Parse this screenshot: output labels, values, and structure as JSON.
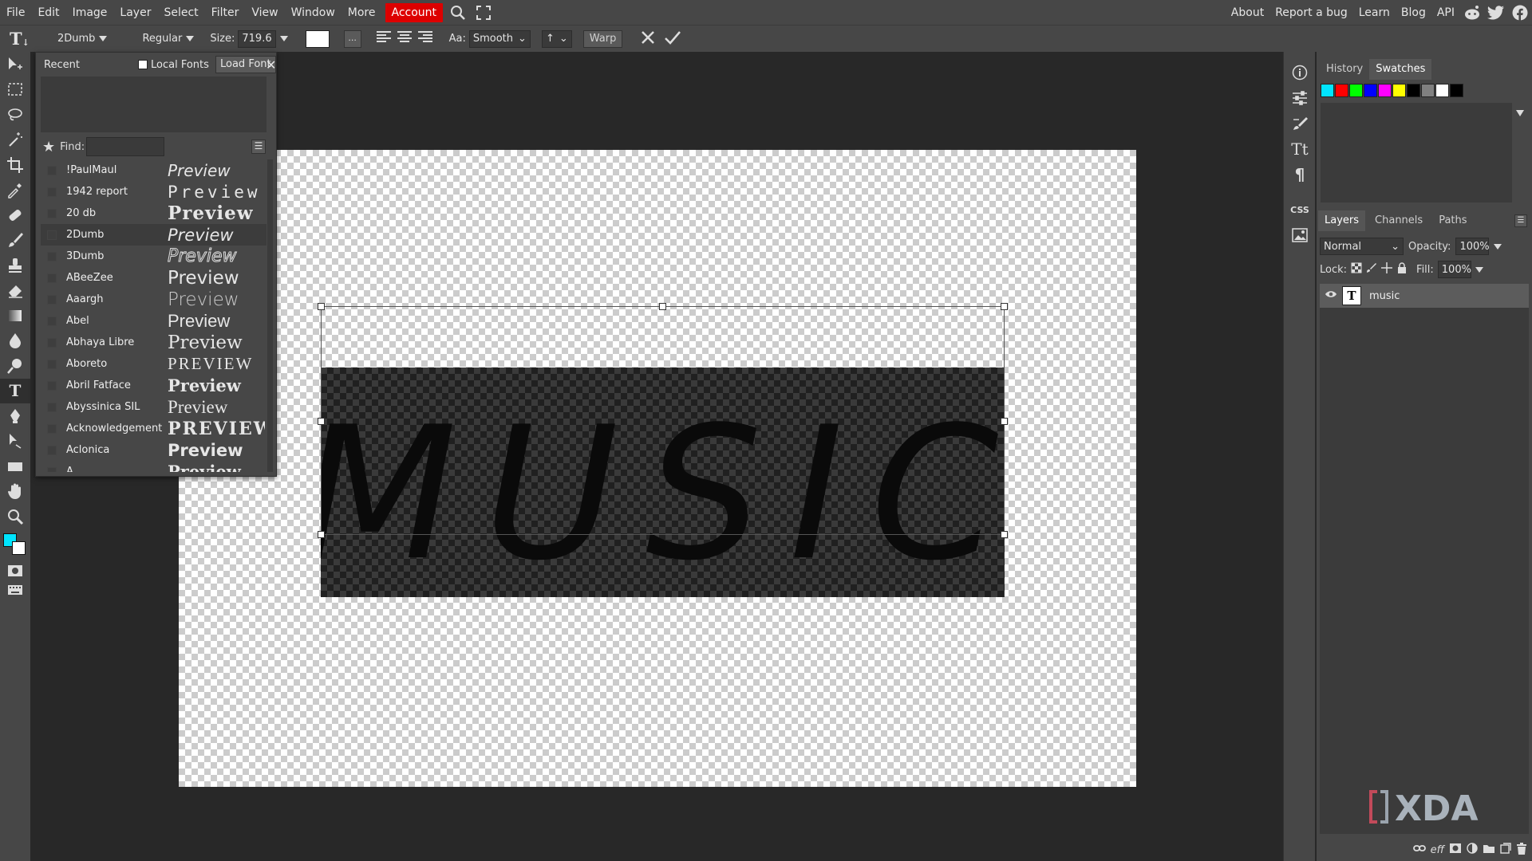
{
  "menubar": {
    "items": [
      "File",
      "Edit",
      "Image",
      "Layer",
      "Select",
      "Filter",
      "View",
      "Window",
      "More"
    ],
    "account": "Account",
    "right_links": [
      "About",
      "Report a bug",
      "Learn",
      "Blog",
      "API"
    ]
  },
  "options": {
    "tool_letter": "T",
    "font_family": "2Dumb",
    "font_style": "Regular",
    "size_label": "Size:",
    "size_value": "719.6",
    "more_btn": "...",
    "aa_label": "Aa:",
    "aa_value": "Smooth",
    "leading_value": "↑",
    "warp": "Warp"
  },
  "fontpanel": {
    "recent_label": "Recent",
    "local_fonts": "Local Fonts",
    "load_font": "Load Font",
    "find_label": "Find:",
    "fonts": [
      {
        "name": "!PaulMaul",
        "preview": "Preview"
      },
      {
        "name": "1942 report",
        "preview": "Preview"
      },
      {
        "name": "20 db",
        "preview": "Preview"
      },
      {
        "name": "2Dumb",
        "preview": "Preview"
      },
      {
        "name": "3Dumb",
        "preview": "Preview"
      },
      {
        "name": "ABeeZee",
        "preview": "Preview"
      },
      {
        "name": "Aaargh",
        "preview": "Preview"
      },
      {
        "name": "Abel",
        "preview": "Preview"
      },
      {
        "name": "Abhaya Libre",
        "preview": "Preview"
      },
      {
        "name": "Aboreto",
        "preview": "PREVIEW"
      },
      {
        "name": "Abril Fatface",
        "preview": "Preview"
      },
      {
        "name": "Abyssinica SIL",
        "preview": "Preview"
      },
      {
        "name": "Acknowledgement",
        "preview": "PREVIEW"
      },
      {
        "name": "Aclonica",
        "preview": "Preview"
      },
      {
        "name": "A",
        "preview": "Preview"
      }
    ]
  },
  "canvas": {
    "text": "MUSIC"
  },
  "rightpanel": {
    "top_tabs": [
      "History",
      "Swatches"
    ],
    "swatch_colors": [
      "#00e5ff",
      "#ff0000",
      "#00ff00",
      "#0000ff",
      "#ff00ff",
      "#ffff00",
      "#000000",
      "#808080",
      "#ffffff",
      "#000000"
    ],
    "layer_tabs": [
      "Layers",
      "Channels",
      "Paths"
    ],
    "blend_mode": "Normal",
    "opacity_label": "Opacity:",
    "opacity_value": "100%",
    "lock_label": "Lock:",
    "fill_label": "Fill:",
    "fill_value": "100%",
    "layer_name": "music",
    "layer_thumb": "T",
    "bottom_fx": "eff"
  },
  "rcol": {
    "css_label": "CSS"
  },
  "watermark": "XDA",
  "colors": {
    "accent_account": "#dd0000",
    "fg_color": "#00e5ff",
    "bg_color": "#ffffff"
  }
}
